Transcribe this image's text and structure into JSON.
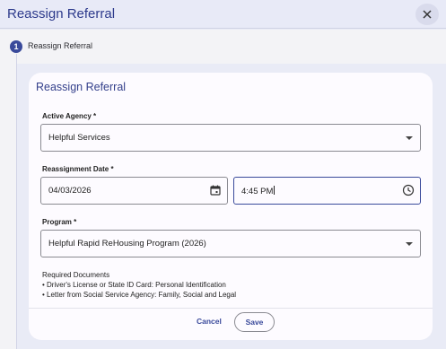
{
  "header": {
    "title": "Reassign Referral",
    "close_icon": "close-icon"
  },
  "stepper": {
    "step_number": "1",
    "step_label": "Reassign Referral"
  },
  "card": {
    "title": "Reassign Referral",
    "active_agency": {
      "label": "Active Agency *",
      "value": "Helpful Services"
    },
    "reassignment_date": {
      "label": "Reassignment Date *",
      "date": "04/03/2026",
      "time": "4:45 PM"
    },
    "program": {
      "label": "Program *",
      "value": "Helpful Rapid ReHousing Program (2026)"
    },
    "required_documents": {
      "title": "Required Documents",
      "items": [
        "• Driver's License or State ID Card: Personal Identification",
        "• Letter from Social Service Agency: Family, Social and Legal"
      ]
    },
    "actions": {
      "cancel": "Cancel",
      "save": "Save"
    }
  },
  "colors": {
    "accent": "#3a4a9b",
    "title": "#2d3a8c",
    "background": "#e9ebf6"
  }
}
